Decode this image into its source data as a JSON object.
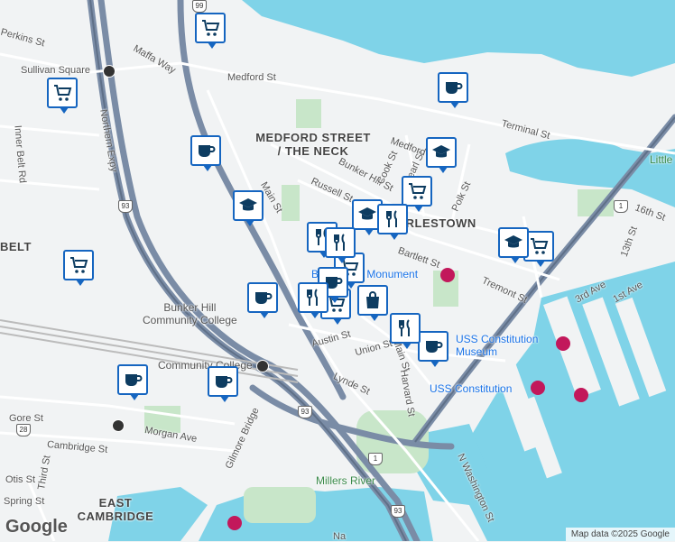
{
  "map": {
    "neighborhood_labels": [
      {
        "id": "medford-neck",
        "text": "MEDFORD STREET\n/ THE NECK"
      },
      {
        "id": "charlestown",
        "text": "CHARLESTOWN"
      },
      {
        "id": "belt",
        "text": "BELT"
      },
      {
        "id": "east-cambridge",
        "text": "EAST\nCAMBRIDGE"
      }
    ],
    "street_labels": [
      "Perkins St",
      "Maffa Way",
      "Sullivan Square",
      "Medford St",
      "Northern Expy",
      "Inner Belt Rd",
      "Main St",
      "Russell St",
      "Bunker Hill St",
      "Cook St",
      "Pearl St",
      "Polk St",
      "Terminal St",
      "16th St",
      "13th St",
      "Bartlett St",
      "Tremont St",
      "3rd Ave",
      "1st Ave",
      "Austin St",
      "Union St",
      "Main St",
      "Harvard St",
      "Lynde St",
      "Gore St",
      "Cambridge St",
      "Morgan Ave",
      "Gilmore Bridge",
      "Otis St",
      "Third St",
      "Spring St",
      "Millers River",
      "N Washington St",
      "Medford",
      "Little Ch",
      "Na"
    ],
    "poi_labels": [
      "Bunker Hill Monument",
      "USS Constitution Museum",
      "USS Constitution",
      "Community College",
      "Bunker Hill\nCommunity College"
    ],
    "attribution": "Map data ©2025 Google",
    "logo": "Google",
    "route_shields": [
      "99",
      "93",
      "93",
      "1",
      "1",
      "93",
      "28"
    ],
    "pins": [
      {
        "type": "cart-icon"
      },
      {
        "type": "cart-icon"
      },
      {
        "type": "cart-icon"
      },
      {
        "type": "cart-icon"
      },
      {
        "type": "cart-icon"
      },
      {
        "type": "cart-icon"
      },
      {
        "type": "cart-icon"
      },
      {
        "type": "cup-icon"
      },
      {
        "type": "cup-icon"
      },
      {
        "type": "cup-icon"
      },
      {
        "type": "cup-icon"
      },
      {
        "type": "cup-icon"
      },
      {
        "type": "cup-icon"
      },
      {
        "type": "cup-icon"
      },
      {
        "type": "cap-icon"
      },
      {
        "type": "cap-icon"
      },
      {
        "type": "cap-icon"
      },
      {
        "type": "cap-icon"
      },
      {
        "type": "fork-icon"
      },
      {
        "type": "fork-icon"
      },
      {
        "type": "fork-icon"
      },
      {
        "type": "fork-icon"
      },
      {
        "type": "fork-icon"
      },
      {
        "type": "bag-icon"
      }
    ],
    "colors": {
      "water": "#7fd3e8",
      "park": "#c8e6c9",
      "land": "#f1f3f4",
      "highway": "#7a8ca6",
      "pin": "#1565c0"
    }
  }
}
